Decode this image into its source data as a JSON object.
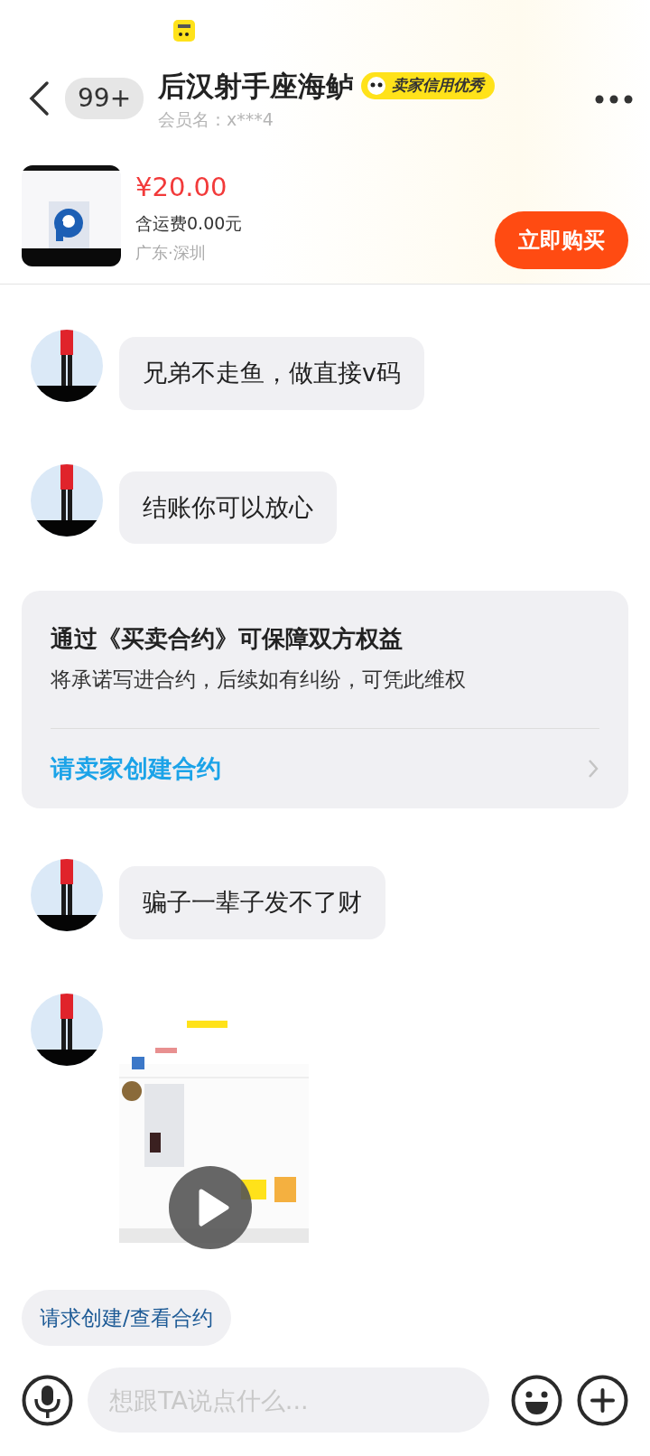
{
  "header": {
    "back_count": "99+",
    "title": "后汉射手座海鲈",
    "badge": "卖家信用优秀",
    "member": "会员名：x***4"
  },
  "product": {
    "price": "¥20.00",
    "shipping": "含运费0.00元",
    "location": "广东·深圳",
    "buy_button": "立即购买"
  },
  "messages": [
    {
      "kind": "text",
      "text": "兄弟不走鱼，做直接v码"
    },
    {
      "kind": "text",
      "text": "结账你可以放心"
    },
    {
      "kind": "contract",
      "title": "通过《买卖合约》可保障双方权益",
      "body": "将承诺写进合约，后续如有纠纷，可凭此维权",
      "link": "请卖家创建合约"
    },
    {
      "kind": "text",
      "text": "骗子一辈子发不了财"
    },
    {
      "kind": "video"
    }
  ],
  "quick_action": "请求创建/查看合约",
  "composer": {
    "placeholder": "想跟TA说点什么..."
  }
}
